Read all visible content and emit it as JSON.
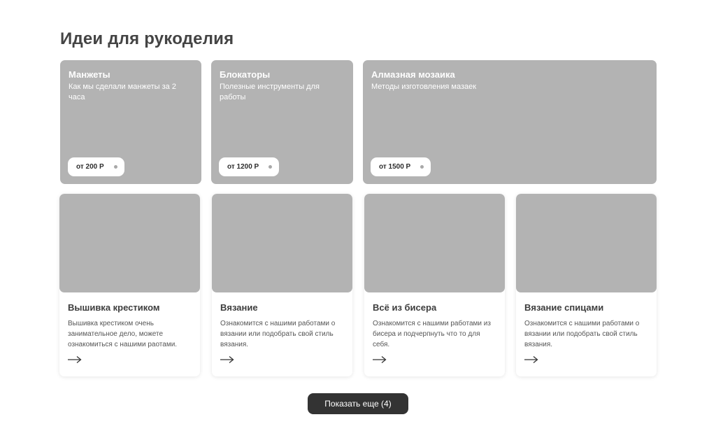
{
  "page_title": "Идеи для рукоделия",
  "tiles": [
    {
      "title": "Манжеты",
      "subtitle": "Как мы сделали манжеты за 2 часа",
      "price": "от 200 Р"
    },
    {
      "title": "Блокаторы",
      "subtitle": "Полезные инструменты для работы",
      "price": "от 1200 Р"
    },
    {
      "title": "Алмазная мозаика",
      "subtitle": "Методы изготовления мазаек",
      "price": "от 1500 Р"
    }
  ],
  "cards": [
    {
      "title": "Вышивка крестиком",
      "text": "Вышивка крестиком очень занимательное дело, можете ознакомиться с нашими раотами.",
      "icon": "arrow-right-icon"
    },
    {
      "title": "Вязание",
      "text": "Ознакомится с нашими работами о вязании или подобрать свой стиль вязания.",
      "icon": "arrow-right-icon"
    },
    {
      "title": "Всё из бисера",
      "text": "Ознакомится с нашими работами из бисера и подчерпнуть что то для себя.",
      "icon": "arrow-right-icon"
    },
    {
      "title": "Вязание спицами",
      "text": "Ознакомится с нашими работами о вязании или подобрать свой стиль вязания.",
      "icon": "arrow-right-icon"
    }
  ],
  "show_more_label": "Показать еще (4)",
  "colors": {
    "placeholder": "#b3b3b3",
    "button_bg": "#333333",
    "text_dark": "#3d3d3d"
  }
}
